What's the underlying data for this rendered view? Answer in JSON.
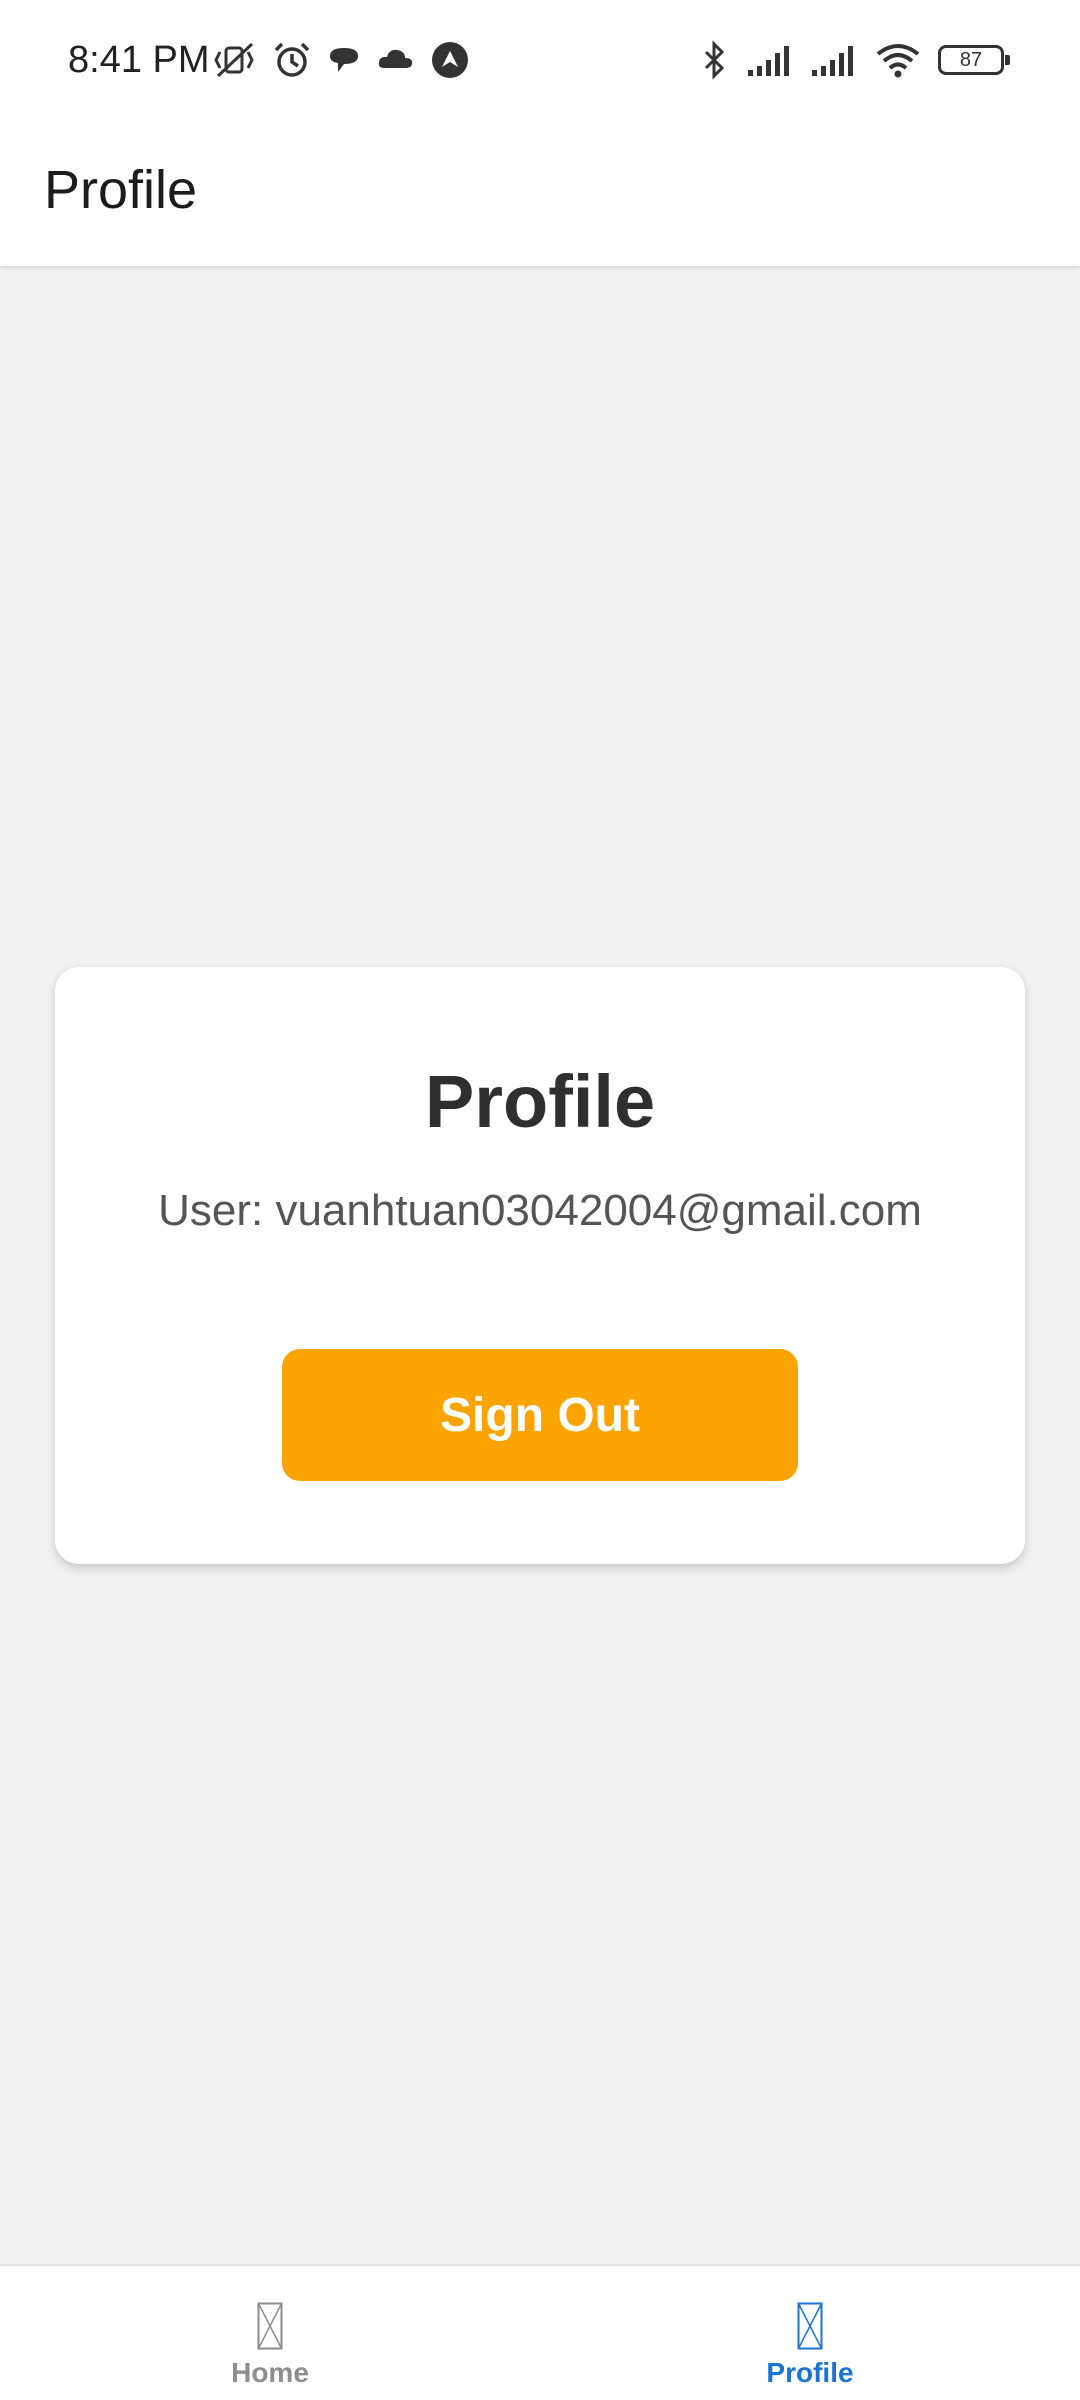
{
  "status_bar": {
    "time": "8:41 PM",
    "battery_level": "87",
    "left_icons": [
      "vibrate-muted-icon",
      "alarm-icon",
      "chat-bubble-icon",
      "cloud-icon",
      "nav-arrow-icon"
    ],
    "right_icons": [
      "bluetooth-icon",
      "signal-icon",
      "signal-icon",
      "wifi-icon",
      "battery-icon"
    ]
  },
  "header": {
    "title": "Profile"
  },
  "card": {
    "title": "Profile",
    "user_text": "User: vuanhtuan03042004@gmail.com",
    "sign_out_label": "Sign Out"
  },
  "tabs": [
    {
      "label": "Home",
      "icon": "missing-image-icon",
      "active": false
    },
    {
      "label": "Profile",
      "icon": "missing-image-icon",
      "active": true
    }
  ],
  "colors": {
    "accent": "#fba300",
    "active_tab": "#1a73d9",
    "inactive_tab": "#8e8e8e",
    "background": "#f2f2f2"
  }
}
